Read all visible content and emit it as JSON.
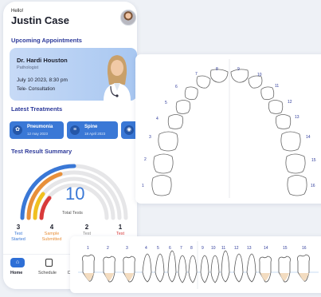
{
  "header": {
    "greeting": "Hello!",
    "user_name": "Justin Case"
  },
  "appointments": {
    "title": "Upcoming Appointments",
    "card": {
      "doctor": "Dr. Hardi Houston",
      "specialty": "Pathologist",
      "datetime": "July 10 2023, 8:30 pm",
      "mode": "Tele- Consultation"
    }
  },
  "treatments": {
    "title": "Latest Treatments",
    "items": [
      {
        "name": "Pneumonia",
        "date": "12 may 2023"
      },
      {
        "name": "Spine",
        "date": "18 April 2023"
      }
    ]
  },
  "tests": {
    "title": "Test Result Summary",
    "total": "10",
    "total_label": "Total Tests",
    "stats": [
      {
        "value": "3",
        "label_l1": "Test",
        "label_l2": "Started",
        "color": "#3a78d6"
      },
      {
        "value": "4",
        "label_l1": "Sample",
        "label_l2": "Submitted",
        "color": "#e8903a"
      },
      {
        "value": "2",
        "label_l1": "Test",
        "label_l2": "",
        "color": "#888888"
      },
      {
        "value": "1",
        "label_l1": "Test",
        "label_l2": "",
        "color": "#d93a3a"
      }
    ]
  },
  "nav": {
    "items": [
      "Home",
      "Schedule",
      "D"
    ]
  },
  "dental_chart": {
    "arch_numbers": [
      "1",
      "2",
      "3",
      "4",
      "5",
      "6",
      "7",
      "8",
      "9",
      "10",
      "11",
      "12",
      "13",
      "14",
      "15",
      "16"
    ]
  },
  "tooth_strip": {
    "numbers": [
      "1",
      "2",
      "3",
      "4",
      "5",
      "6",
      "7",
      "8",
      "9",
      "10",
      "11",
      "12",
      "13",
      "14",
      "15",
      "16"
    ]
  },
  "colors": {
    "accent": "#2e6fd6",
    "title": "#2d3a9a",
    "card": "#b7d0f4"
  }
}
